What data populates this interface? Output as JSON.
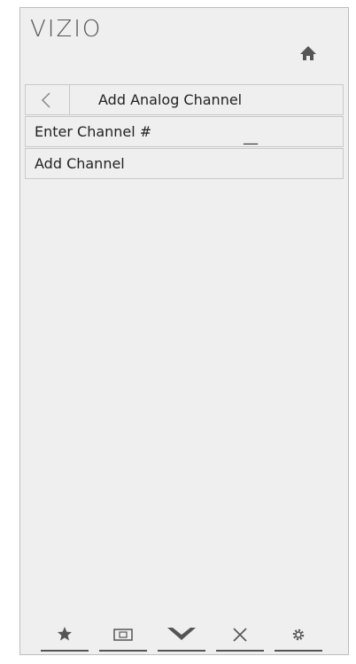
{
  "brand": "VIZIO",
  "menu": {
    "title": "Add Analog Channel",
    "rows": [
      {
        "label": "Enter Channel #",
        "value": "__"
      },
      {
        "label": "Add Channel"
      }
    ]
  },
  "icons": [
    "home-icon",
    "back-icon",
    "favorite-star-icon",
    "input-icon",
    "chevron-down-icon",
    "close-icon",
    "gear-icon"
  ],
  "colors": {
    "panel": "#efefef",
    "text": "#222222",
    "border": "#c9c9c9",
    "icon": "#555555"
  }
}
